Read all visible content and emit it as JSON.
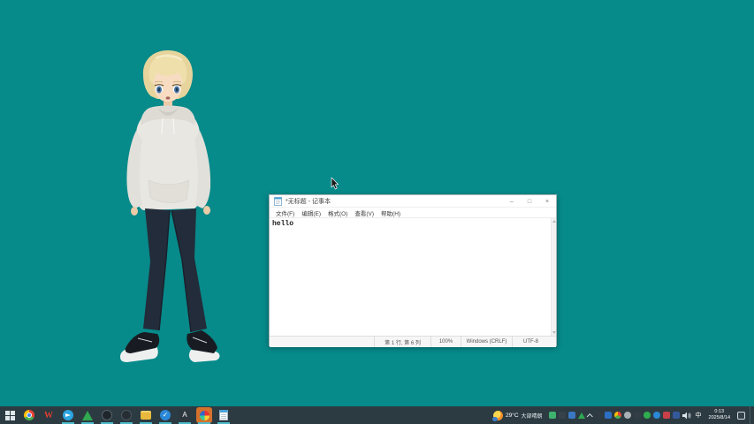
{
  "desktop": {
    "wallpaper_color": "#078a8a",
    "character": "anime-boy-mascot"
  },
  "notepad": {
    "title": "*无标题 - 记事本",
    "controls": {
      "minimize": "–",
      "maximize": "□",
      "close": "×"
    },
    "menus": [
      "文件(F)",
      "编辑(E)",
      "格式(O)",
      "查看(V)",
      "帮助(H)"
    ],
    "text": "hello",
    "status": {
      "cursor_position": "第 1 行, 第 6 列",
      "zoom": "100%",
      "line_ending": "Windows (CRLF)",
      "encoding": "UTF-8"
    }
  },
  "taskbar": {
    "wps_glyph": "W",
    "check_glyph": "✓",
    "a_app_glyph": "A",
    "pinned_apps": [
      "start",
      "chrome",
      "wps",
      "telegram",
      "green-triangle-app",
      "dark-round-app-1",
      "dark-round-app-2",
      "yellow-app",
      "check-app",
      "a-app",
      "mascot-app-active",
      "notepad"
    ],
    "tray": {
      "weather_temperature": "29°C",
      "weather_condition": "大部晴朗",
      "ime_indicator": "中",
      "clock_time": "0:13",
      "clock_date": "2025/8/14",
      "tray_icon_names": [
        "wechat",
        "dark-a-app",
        "blue-app",
        "green-triangle",
        "hidden-icons-chevron",
        "gamepad-dark",
        "info-blue",
        "chrome-tray",
        "gray-app",
        "dark-app",
        "green-shield",
        "check-blue",
        "red-app",
        "mail-blue",
        "volume",
        "ime",
        "clock",
        "notification"
      ]
    }
  },
  "colors": {
    "desktop_teal": "#078a8a",
    "taskbar_dark": "#2c3b42",
    "active_app_orange": "#d4712c",
    "running_indicator": "#4fbccc"
  }
}
